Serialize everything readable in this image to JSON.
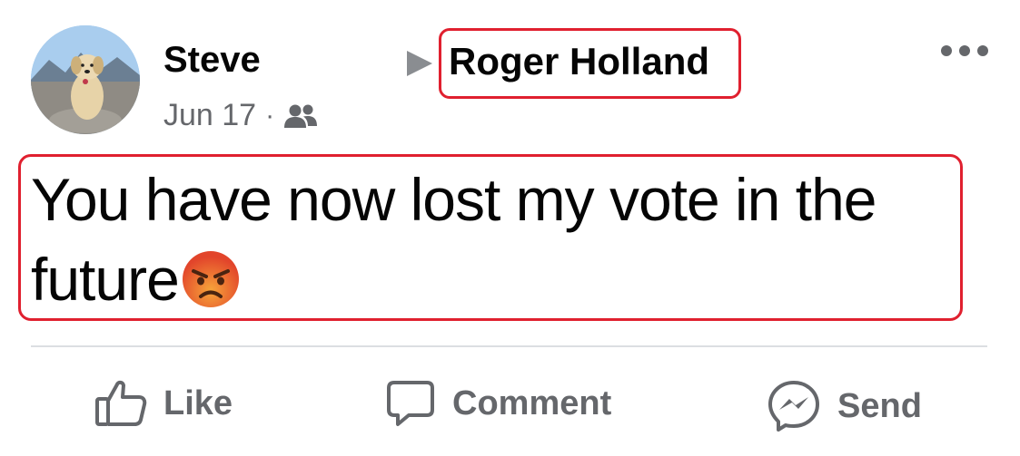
{
  "post": {
    "author": "Steve",
    "date": "Jun 17",
    "separator": "·",
    "audience_icon": "friends-icon",
    "target": "Roger Holland",
    "text": "You have now lost my vote in the future",
    "emoji": "angry-face-emoji"
  },
  "actions": {
    "like_label": "Like",
    "comment_label": "Comment",
    "send_label": "Send"
  },
  "colors": {
    "highlight_border": "#e0202f",
    "secondary_text": "#65676b",
    "primary_text": "#050505"
  }
}
